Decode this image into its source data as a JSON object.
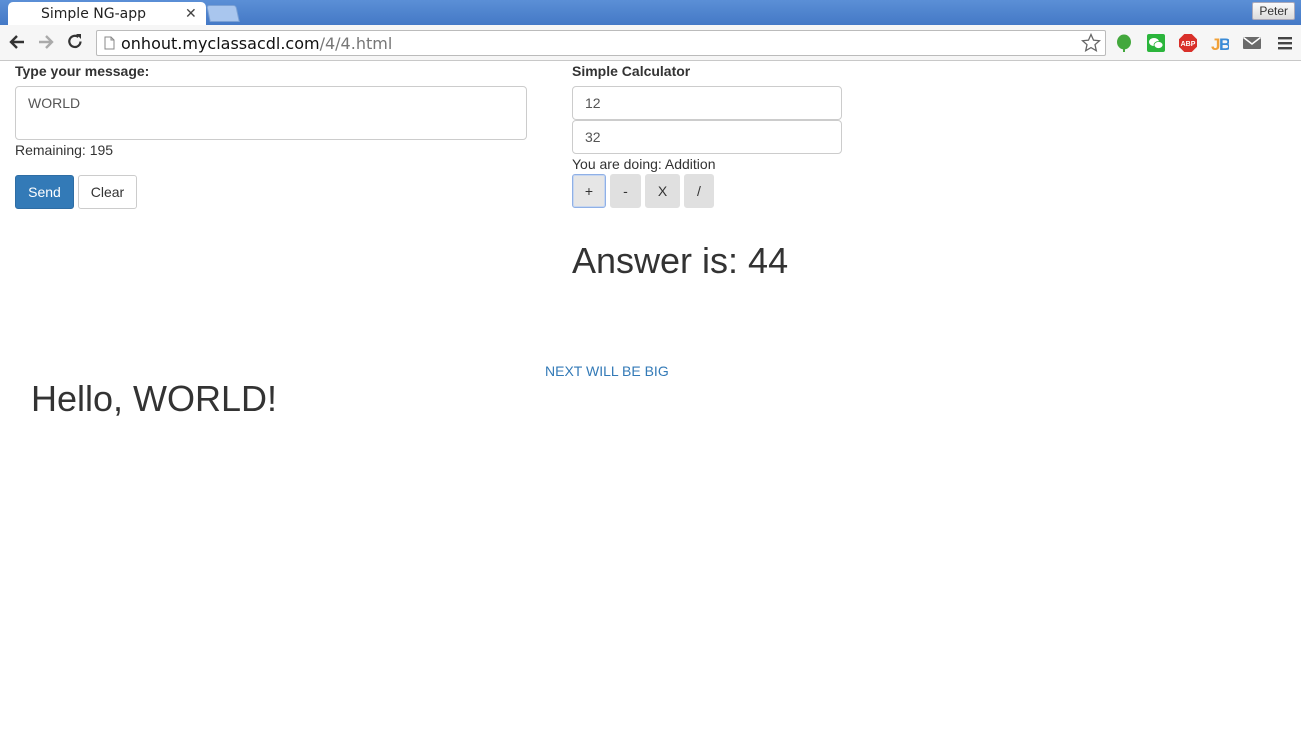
{
  "browser": {
    "tab_title": "Simple NG-app",
    "profile_name": "Peter",
    "url_host": "onhout.myclassacdl.com",
    "url_path": "/4/4.html",
    "extensions": [
      "evernote-icon",
      "wechat-icon",
      "adblock-plus-icon",
      "jetbrains-icon",
      "mail-icon"
    ]
  },
  "message": {
    "label": "Type your message:",
    "text": "WORLD",
    "remaining": "Remaining: 195",
    "send_label": "Send",
    "clear_label": "Clear"
  },
  "calculator": {
    "label": "Simple Calculator",
    "first_value": "12",
    "second_value": "32",
    "doing_text": "You are doing: Addition",
    "operations": [
      "+",
      "-",
      "X",
      "/"
    ],
    "active_operation": "+",
    "answer": "Answer is: 44"
  },
  "footer": {
    "link_text": "NEXT WILL BE BIG",
    "greeting": "Hello, WORLD!"
  },
  "colors": {
    "primary": "#337ab7",
    "tabstrip": "#4a80cb",
    "op_button": "#e0e0e0"
  }
}
